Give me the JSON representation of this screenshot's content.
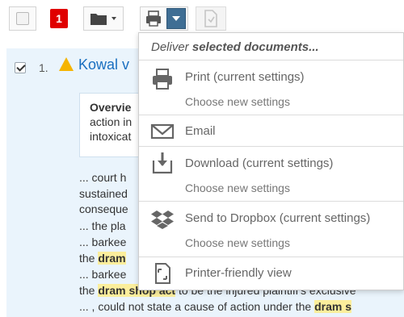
{
  "toolbar": {
    "badge_count": "1"
  },
  "result": {
    "number": "1.",
    "title": "Kowal v",
    "overview_label": "Overvie",
    "overview_lines": [
      "action in",
      "intoxicat"
    ],
    "snippets": [
      {
        "pre": "... court h",
        "hl": "",
        "post": ""
      },
      {
        "pre": "sustained",
        "hl": "",
        "post": ""
      },
      {
        "pre": "conseque",
        "hl": "",
        "post": ""
      },
      {
        "pre": "... the pla",
        "hl": "",
        "post": ""
      },
      {
        "pre": "... barkee",
        "hl": "",
        "post": ""
      },
      {
        "pre": "the ",
        "hl": "dram",
        "post": ""
      },
      {
        "pre": "... barkee",
        "hl": "",
        "post": ""
      },
      {
        "pre": "the ",
        "hl": "dram shop act",
        "post": " to be the injured plaintiff's exclusive"
      },
      {
        "pre": "... , could not state a cause of action under the ",
        "hl": "dram s",
        "post": ""
      }
    ]
  },
  "dropdown": {
    "header_prefix": "Deliver ",
    "header_strong": "selected documents...",
    "items": [
      {
        "label": "Print (current settings)",
        "sub": "Choose new settings",
        "icon": "printer-icon"
      },
      {
        "label": "Email",
        "sub": "",
        "icon": "email-icon"
      },
      {
        "label": "Download (current settings)",
        "sub": "Choose new settings",
        "icon": "download-icon"
      },
      {
        "label": "Send to Dropbox (current settings)",
        "sub": "Choose new settings",
        "icon": "dropbox-icon"
      },
      {
        "label": "Printer-friendly view",
        "sub": "",
        "icon": "printer-friendly-icon"
      }
    ]
  },
  "colors": {
    "accent": "#3f6e94",
    "badge": "#e00000",
    "link": "#1a6fc0",
    "highlight": "#fbee9c",
    "warning": "#f5b400"
  }
}
